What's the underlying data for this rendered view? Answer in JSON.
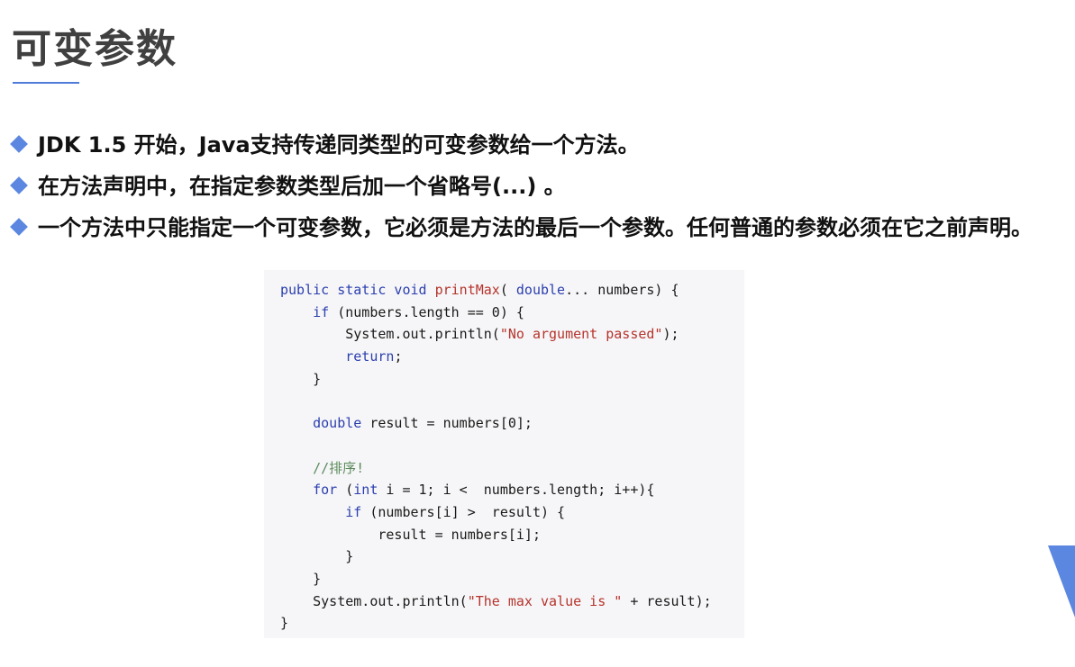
{
  "title": "可变参数",
  "bullets": [
    "JDK 1.5 开始，Java支持传递同类型的可变参数给一个方法。",
    "在方法声明中，在指定参数类型后加一个省略号(...) 。",
    "一个方法中只能指定一个可变参数，它必须是方法的最后一个参数。任何普通的参数必须在它之前声明。"
  ],
  "code": {
    "l1": {
      "kw1": "public static void ",
      "fn": "printMax",
      "p1": "( ",
      "kw2": "double",
      "p2": "... numbers) {"
    },
    "l2": {
      "indent": "    ",
      "kw": "if",
      "rest": " (numbers.length == 0) {"
    },
    "l3": {
      "indent": "        ",
      "a": "System.out.println(",
      "str": "\"No argument passed\"",
      "b": ");"
    },
    "l4": {
      "indent": "        ",
      "kw": "return",
      "rest": ";"
    },
    "l5": "    }",
    "l6": "",
    "l7": {
      "indent": "    ",
      "kw": "double",
      "rest": " result = numbers[0];"
    },
    "l8": "",
    "l9": {
      "indent": "    ",
      "cm": "//排序!"
    },
    "l10": {
      "indent": "    ",
      "kw1": "for",
      "a": " (",
      "kw2": "int",
      "b": " i = 1; i <  numbers.length; i++){"
    },
    "l11": {
      "indent": "        ",
      "kw": "if",
      "rest": " (numbers[i] >  result) {"
    },
    "l12": "            result = numbers[i];",
    "l13": "        }",
    "l14": "    }",
    "l15": {
      "indent": "    ",
      "a": "System.out.println(",
      "str": "\"The max value is \"",
      "b": " + result);"
    },
    "l16": "}"
  },
  "colors": {
    "accent": "#5b87e0",
    "keyword": "#2b3fae",
    "string": "#b6342c",
    "comment": "#5a8a5a"
  }
}
